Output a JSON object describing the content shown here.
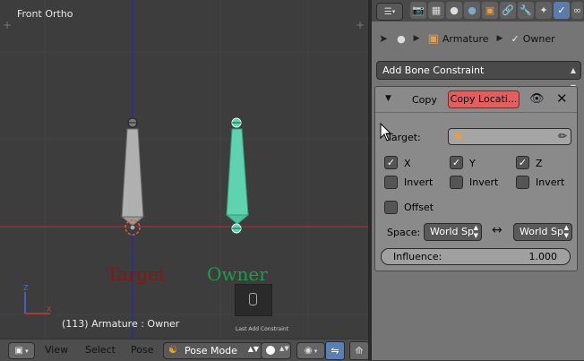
{
  "viewport": {
    "title": "Front Ortho",
    "status": "(113) Armature : Owner",
    "bone_labels": {
      "target": "Target",
      "owner": "Owner"
    },
    "hint_text": "Last Add Constraint",
    "colors": {
      "target_bone": "#b0b0b0",
      "owner_bone": "#5fd3b0",
      "x_axis": "#b03232",
      "z_axis": "#2a2a9a"
    }
  },
  "header": {
    "view": "View",
    "select": "Select",
    "pose": "Pose",
    "mode": "Pose Mode"
  },
  "properties": {
    "tabs": [
      "render-icon",
      "render-layers-icon",
      "scene-icon",
      "world-icon",
      "object-icon",
      "constraints-icon",
      "modifiers-icon",
      "data-icon",
      "bone-icon",
      "bone-constraints-icon"
    ],
    "breadcrumb": {
      "armature": "Armature",
      "bone": "Owner"
    },
    "add_constraint": "Add Bone Constraint",
    "constraint": {
      "type": "Copy",
      "name": "Copy Locati...",
      "target_label": "Target:",
      "x_label": "X",
      "y_label": "Y",
      "z_label": "Z",
      "x_checked": true,
      "y_checked": true,
      "z_checked": true,
      "invert_label": "Invert",
      "offset_label": "Offset",
      "space_label": "Space:",
      "owner_space": "World Sp",
      "target_space": "World Sp",
      "influence_label": "Influence:",
      "influence_value": "1.000"
    }
  }
}
